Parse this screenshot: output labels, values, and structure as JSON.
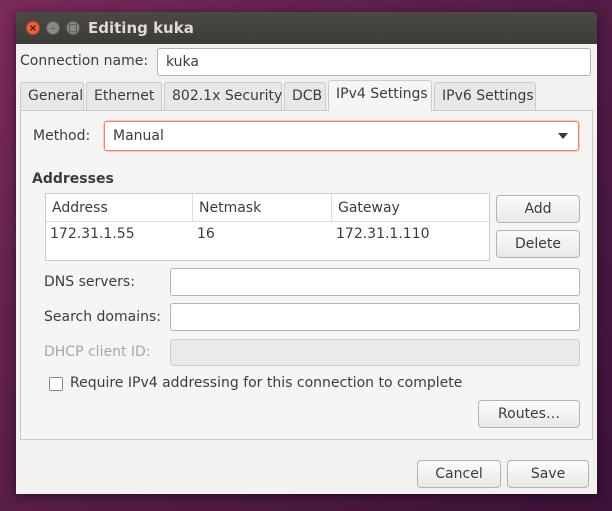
{
  "window": {
    "title": "Editing kuka"
  },
  "connection": {
    "label": "Connection name:",
    "value": "kuka"
  },
  "tabs": [
    "General",
    "Ethernet",
    "802.1x Security",
    "DCB",
    "IPv4 Settings",
    "IPv6 Settings"
  ],
  "method": {
    "label": "Method:",
    "value": "Manual"
  },
  "addresses": {
    "heading": "Addresses",
    "columns": [
      "Address",
      "Netmask",
      "Gateway"
    ],
    "rows": [
      [
        "172.31.1.55",
        "16",
        "172.31.1.110"
      ]
    ],
    "add_label": "Add",
    "delete_label": "Delete"
  },
  "dns": {
    "label": "DNS servers:",
    "value": ""
  },
  "search_domains": {
    "label": "Search domains:",
    "value": ""
  },
  "dhcp_client_id": {
    "label": "DHCP client ID:",
    "value": ""
  },
  "require_ipv4": {
    "label": "Require IPv4 addressing for this connection to complete",
    "checked": false
  },
  "routes_label": "Routes…",
  "footer": {
    "cancel_label": "Cancel",
    "save_label": "Save"
  }
}
